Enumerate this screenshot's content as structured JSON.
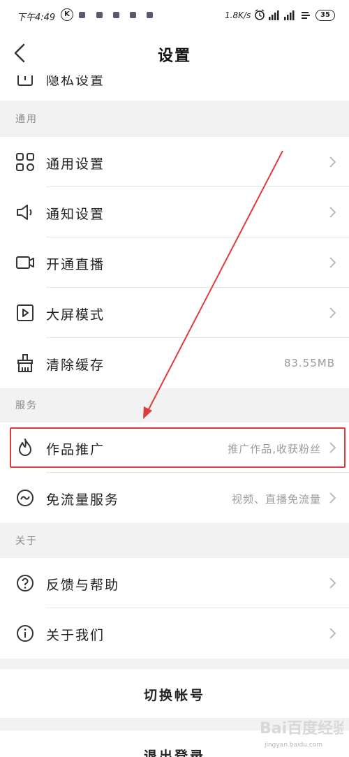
{
  "status_bar": {
    "time": "下午4:49",
    "k_badge": "K",
    "net_speed": "1.8K/s",
    "battery": "35"
  },
  "nav": {
    "title": "设置"
  },
  "rows": {
    "privacy": {
      "label": "隐私设置"
    },
    "general": {
      "label": "通用设置"
    },
    "notify": {
      "label": "通知设置"
    },
    "live": {
      "label": "开通直播"
    },
    "bigscreen": {
      "label": "大屏模式"
    },
    "cache": {
      "label": "清除缓存",
      "value": "83.55MB"
    },
    "promote": {
      "label": "作品推广",
      "value": "推广作品,收获粉丝"
    },
    "freeflow": {
      "label": "免流量服务",
      "value": "视频、直播免流量"
    },
    "feedback": {
      "label": "反馈与帮助"
    },
    "about": {
      "label": "关于我们"
    }
  },
  "sections": {
    "general": "通用",
    "service": "服务",
    "about": "关于"
  },
  "buttons": {
    "switch_account": "切换帐号",
    "logout": "退出登录"
  },
  "watermark": {
    "logo": "Bai百度经验",
    "url": "jingyan.baidu.com"
  },
  "colors": {
    "annotation_red": "#e03b3b",
    "page_bg": "#f2f2f2"
  }
}
